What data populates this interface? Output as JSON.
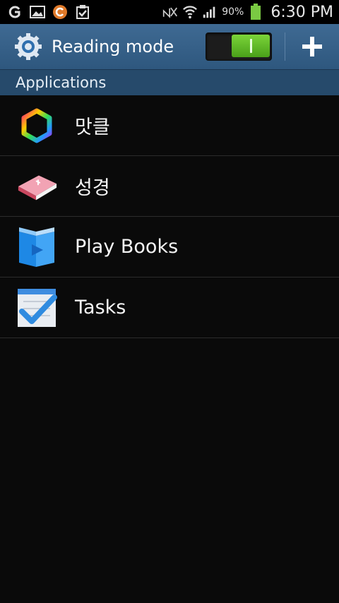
{
  "status_bar": {
    "battery_percent": "90%",
    "time": "6:30 PM",
    "icons": [
      "g-icon",
      "gallery-icon",
      "c-app-icon",
      "clipboard-check-icon",
      "no-signal-icon",
      "wifi-icon",
      "signal-icon",
      "battery-icon"
    ]
  },
  "action_bar": {
    "title": "Reading mode",
    "toggle_state": "on",
    "icons": [
      "gear-icon",
      "add-icon"
    ],
    "colors": {
      "bar": "#34618b",
      "toggle_on": "#5cb52a"
    }
  },
  "section": {
    "header": "Applications"
  },
  "apps": [
    {
      "label": "맛클",
      "icon": "hexagon-rainbow-icon"
    },
    {
      "label": "성경",
      "icon": "bible-book-icon"
    },
    {
      "label": "Play Books",
      "icon": "play-books-icon"
    },
    {
      "label": "Tasks",
      "icon": "tasks-checkmark-icon"
    }
  ]
}
